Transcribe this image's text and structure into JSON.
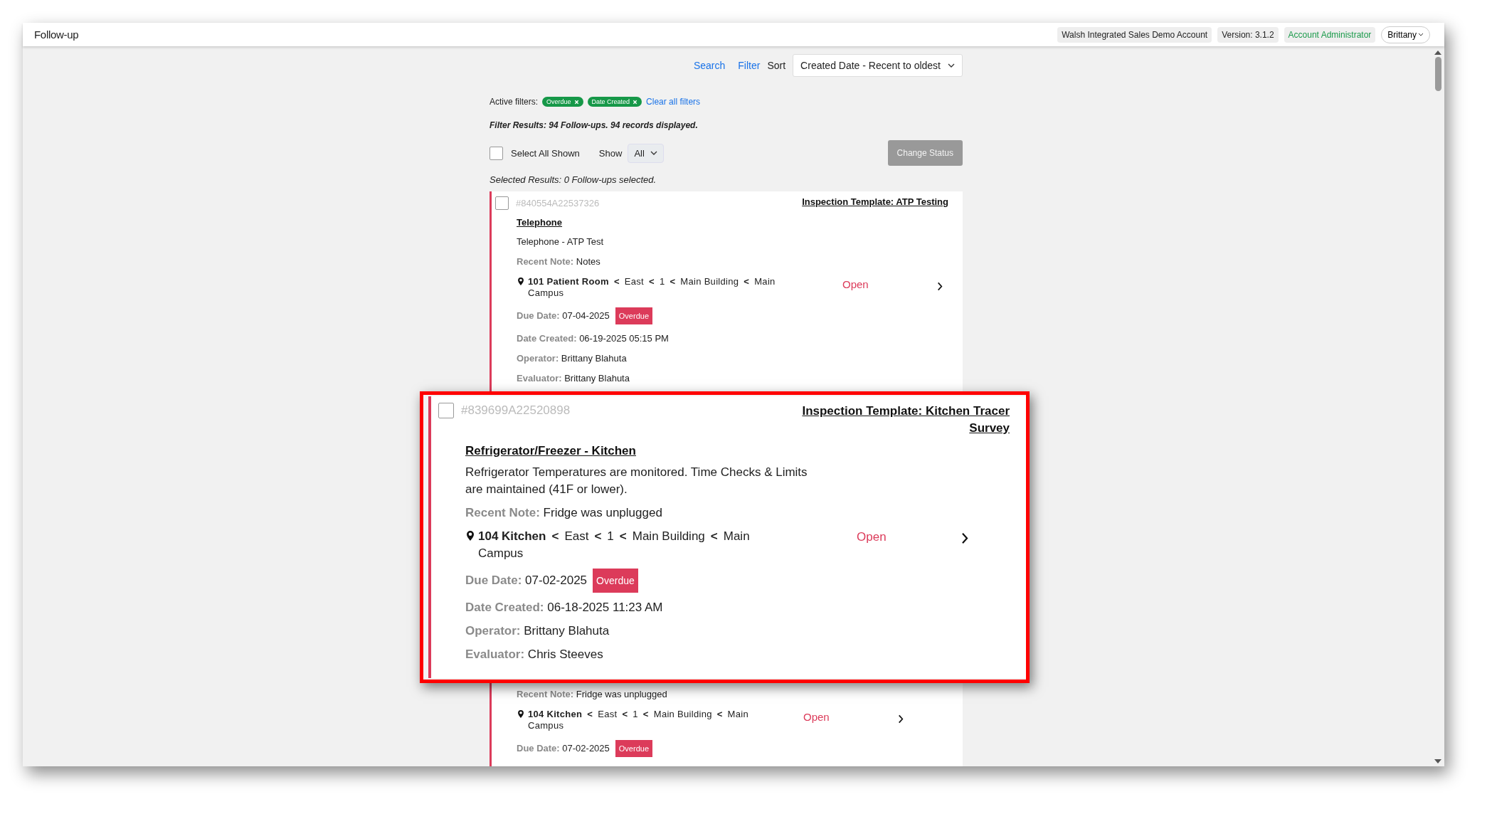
{
  "app_bar": {
    "title": "Follow-up",
    "account": "Walsh Integrated Sales Demo Account",
    "version": "Version: 3.1.2",
    "role": "Account Administrator",
    "user": "Brittany"
  },
  "toolbar": {
    "search": "Search",
    "filter": "Filter",
    "sort_label": "Sort",
    "sort_value": "Created Date - Recent to oldest"
  },
  "active_filters": {
    "label": "Active filters:",
    "chips": [
      "Overdue",
      "Date Created"
    ],
    "clear": "Clear all filters"
  },
  "filter_results": "Filter Results: 94 Follow-ups. 94 records displayed.",
  "select_all": {
    "label": "Select All Shown",
    "checked": false
  },
  "show": {
    "label": "Show",
    "value": "All"
  },
  "change_status": {
    "label": "Change Status",
    "disabled": true
  },
  "selected_results": "Selected Results: 0 Follow-ups selected.",
  "cards": [
    {
      "kind": "normal",
      "overdue": true,
      "checked": false,
      "id": "#840554A22537326",
      "template": "Inspection Template: ATP Testing",
      "title": "Telephone",
      "description": "Telephone - ATP Test",
      "status": "Open",
      "rows": [
        {
          "kind": "field",
          "label": "Recent Note:",
          "value": "Notes"
        },
        {
          "kind": "location",
          "room": "101 Patient Room",
          "separator": "<",
          "path": [
            "East",
            "1",
            "Main Building",
            "Main Campus"
          ]
        },
        {
          "kind": "due",
          "label": "Due Date:",
          "value": "07-04-2025",
          "badge": "Overdue"
        },
        {
          "kind": "field",
          "label": "Date Created:",
          "value": "06-19-2025 05:15 PM"
        },
        {
          "kind": "field",
          "label": "Operator:",
          "value": "Brittany Blahuta"
        },
        {
          "kind": "field",
          "label": "Evaluator:",
          "value": "Brittany Blahuta"
        }
      ]
    },
    {
      "kind": "callout",
      "overdue": true,
      "checked": false,
      "id": "#839699A22520898",
      "template": "Inspection Template: Kitchen Tracer Survey",
      "title": "Refrigerator/Freezer - Kitchen",
      "description": "Refrigerator Temperatures are monitored. Time Checks & Limits are maintained (41F or lower).",
      "status": "Open",
      "rows": [
        {
          "kind": "field",
          "label": "Recent Note:",
          "value": "Fridge was unplugged"
        },
        {
          "kind": "location",
          "room": "104 Kitchen",
          "separator": "<",
          "path": [
            "East",
            "1",
            "Main Building",
            "Main Campus"
          ]
        },
        {
          "kind": "due",
          "label": "Due Date:",
          "value": "07-02-2025",
          "badge": "Overdue"
        },
        {
          "kind": "field",
          "label": "Date Created:",
          "value": "06-18-2025 11:23 AM"
        },
        {
          "kind": "field",
          "label": "Operator:",
          "value": "Brittany Blahuta"
        },
        {
          "kind": "field",
          "label": "Evaluator:",
          "value": "Chris Steeves"
        }
      ]
    },
    {
      "kind": "partial",
      "overdue": true,
      "status": "Open",
      "rows": [
        {
          "kind": "field",
          "label": "Recent Note:",
          "value": "Fridge was unplugged"
        },
        {
          "kind": "location",
          "room": "104 Kitchen",
          "separator": "<",
          "path": [
            "East",
            "1",
            "Main Building",
            "Main Campus"
          ]
        },
        {
          "kind": "due",
          "label": "Due Date:",
          "value": "07-02-2025",
          "badge": "Overdue"
        }
      ]
    }
  ]
}
